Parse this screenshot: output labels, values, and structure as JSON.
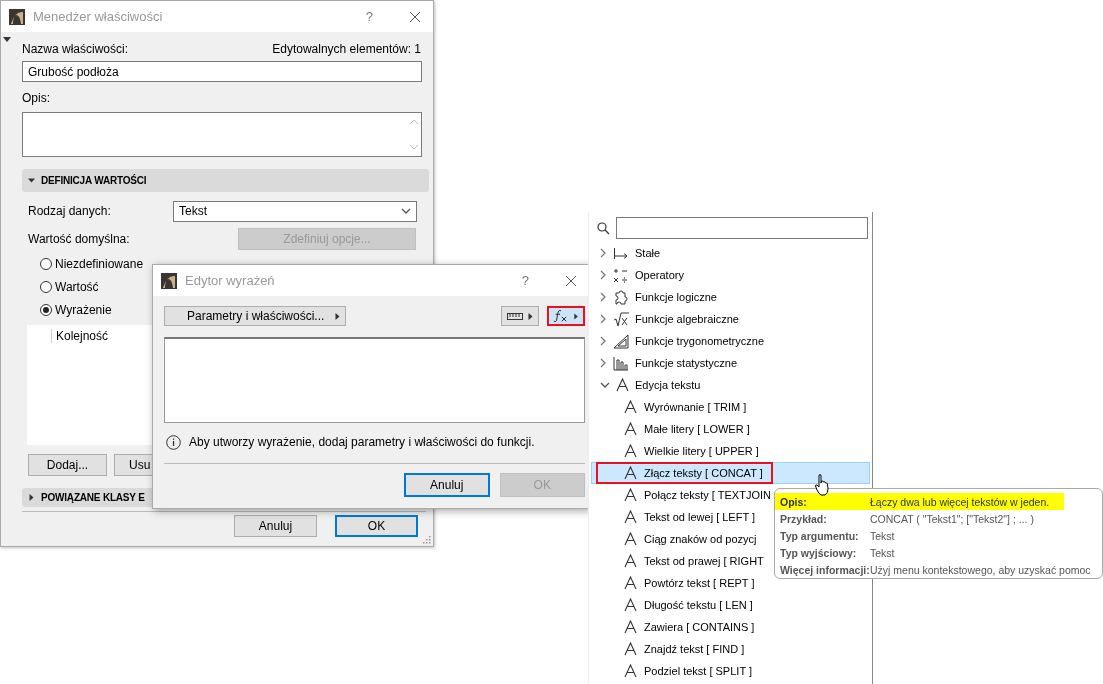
{
  "main_dialog": {
    "title": "Menedżer właściwości",
    "help": "?",
    "edit_count": "Edytowalnych elementów: 1",
    "name_label": "Nazwa właściwości:",
    "name_value": "Grubość podłoża",
    "description_label": "Opis:",
    "value_section": {
      "title": "DEFINICJA WARTOŚCI",
      "expanded": true
    },
    "data_type_label": "Rodzaj danych:",
    "data_type_value": "Tekst",
    "default_label": "Wartość domyślna:",
    "define_options_button": {
      "label": "Zdefiniuj opcje...",
      "disabled": true
    },
    "radios": [
      {
        "label": "Niezdefiniowane",
        "selected": false
      },
      {
        "label": "Wartość",
        "selected": false
      },
      {
        "label": "Wyrażenie",
        "selected": true
      }
    ],
    "order_header": "Kolejność",
    "list_buttons": [
      "Dodaj...",
      "Usu"
    ],
    "classes_section": {
      "title": "POWIĄZANE KLASY E",
      "expanded": false
    },
    "footer_buttons": [
      {
        "label": "Anuluj",
        "default": false
      },
      {
        "label": "OK",
        "default": true
      }
    ]
  },
  "editor_dialog": {
    "title": "Edytor wyrażeń",
    "help": "?",
    "params_button": "Parametry i właściwości...",
    "units_button": {
      "selected": false,
      "annotated": false
    },
    "functions_button": {
      "selected": true,
      "annotated": true
    },
    "info_text": "Aby utworzy wyrażenie, dodaj parametry i właściwości do funkcji.",
    "buttons": [
      {
        "label": "Anuluj",
        "default": true,
        "disabled": false
      },
      {
        "label": "OK",
        "default": false,
        "disabled": true
      }
    ]
  },
  "function_panel": {
    "categories": [
      {
        "label": "Stałe",
        "kind": "constants",
        "expanded": false
      },
      {
        "label": "Operatory",
        "kind": "operators",
        "expanded": false
      },
      {
        "label": "Funkcje logiczne",
        "kind": "logic",
        "expanded": false
      },
      {
        "label": "Funkcje algebraiczne",
        "kind": "algebra",
        "expanded": false
      },
      {
        "label": "Funkcje trygonometryczne",
        "kind": "trig",
        "expanded": false
      },
      {
        "label": "Funkcje statystyczne",
        "kind": "stats",
        "expanded": false
      },
      {
        "label": "Edycja tekstu",
        "kind": "text",
        "expanded": true,
        "children": [
          {
            "label": "Wyrównanie [ TRIM ]",
            "selected": false,
            "annotated": false
          },
          {
            "label": "Małe litery [ LOWER ]",
            "selected": false,
            "annotated": false
          },
          {
            "label": "Wielkie litery [ UPPER ]",
            "selected": false,
            "annotated": false
          },
          {
            "label": "Złącz teksty [ CONCAT ]",
            "selected": true,
            "annotated": true
          },
          {
            "label": "Połącz teksty [ TEXTJOIN",
            "selected": false,
            "annotated": false
          },
          {
            "label": "Tekst od lewej [ LEFT ]",
            "selected": false,
            "annotated": false
          },
          {
            "label": "Ciąg znaków od pozycj",
            "selected": false,
            "annotated": false
          },
          {
            "label": "Tekst od prawej [ RIGHT",
            "selected": false,
            "annotated": false
          },
          {
            "label": "Powtórz tekst [ REPT ]",
            "selected": false,
            "annotated": false
          },
          {
            "label": "Długość tekstu [ LEN ]",
            "selected": false,
            "annotated": false
          },
          {
            "label": "Zawiera [ CONTAINS ]",
            "selected": false,
            "annotated": false
          },
          {
            "label": "Znajdź tekst [ FIND ]",
            "selected": false,
            "annotated": false
          },
          {
            "label": "Podziel tekst [ SPLIT ]",
            "selected": false,
            "annotated": false
          }
        ]
      }
    ]
  },
  "tooltip": {
    "rows": [
      {
        "label": "Opis:",
        "value": "Łączy dwa lub więcej tekstów w jeden.",
        "highlighted": true
      },
      {
        "label": "Przykład:",
        "value": "CONCAT ( \"Tekst1\"; [\"Tekst2\"] ; ... )",
        "highlighted": false
      },
      {
        "label": "Typ argumentu:",
        "value": "Tekst",
        "highlighted": false
      },
      {
        "label": "Typ wyjściowy:",
        "value": "Tekst",
        "highlighted": false
      },
      {
        "label": "Więcej informacji:",
        "value": "Użyj menu kontekstowego, aby uzyskać pomoc",
        "highlighted": false
      }
    ]
  }
}
